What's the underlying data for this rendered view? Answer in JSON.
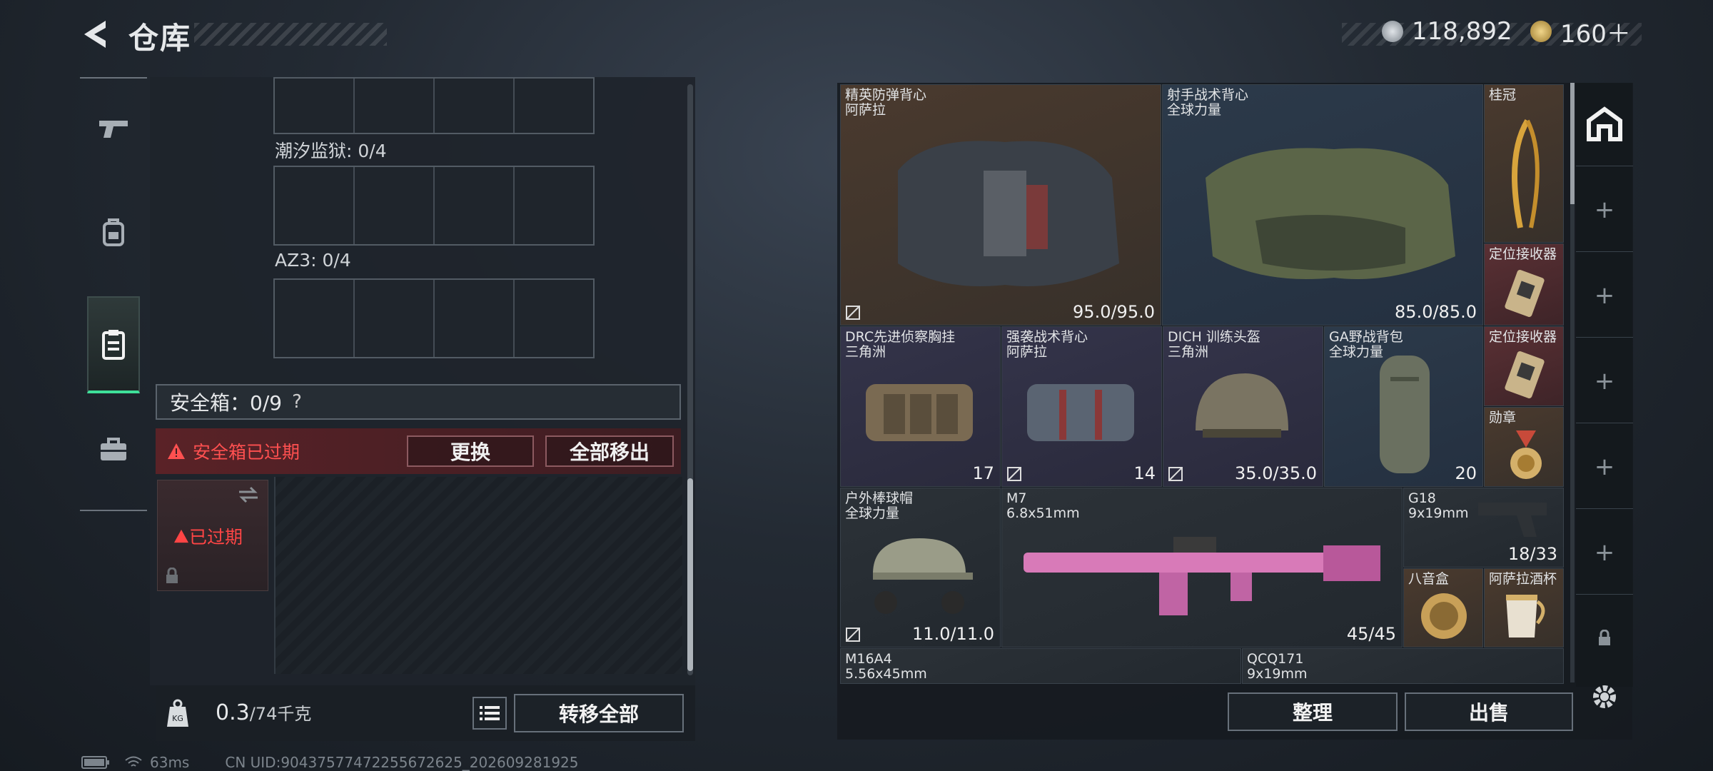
{
  "header": {
    "title": "仓库"
  },
  "currency": [
    {
      "icon": "silver-coin-icon",
      "value": "118,892"
    },
    {
      "icon": "gold-coin-icon",
      "value": "160＋"
    }
  ],
  "left_rail": [
    {
      "icon": "pistol-icon"
    },
    {
      "icon": "backpack-icon"
    },
    {
      "icon": "clipboard-icon",
      "active": true
    },
    {
      "icon": "toolbox-icon"
    }
  ],
  "container_sections": [
    {
      "label": "潮汐监狱: 0/4"
    },
    {
      "label": "AZ3: 0/4"
    }
  ],
  "safe_box": {
    "label": "安全箱：0/9",
    "help": "?",
    "warning": "安全箱已过期",
    "replace_button": "更换",
    "remove_all_button": "全部移出",
    "expired_label": "已过期"
  },
  "weight": {
    "current": "0.3",
    "max": "/74千克",
    "transfer_all_button": "转移全部"
  },
  "inventory": [
    {
      "name": "精英防弹背心\n阿萨拉",
      "value": "95.0/95.0",
      "color": "brown"
    },
    {
      "name": "射手战术背心\n全球力量",
      "value": "85.0/85.0",
      "color": "blue"
    },
    {
      "name": "桂冠",
      "value": "",
      "color": "brown"
    },
    {
      "name": "定位接收器",
      "value": "",
      "color": "red"
    },
    {
      "name": "DRC先进侦察胸挂\n三角洲",
      "value": "17",
      "color": "purple"
    },
    {
      "name": "强袭战术背心\n阿萨拉",
      "value": "14",
      "color": "purple"
    },
    {
      "name": "DICH 训练头盔\n三角洲",
      "value": "35.0/35.0",
      "color": "purple"
    },
    {
      "name": "GA野战背包\n全球力量",
      "value": "20",
      "color": "blue"
    },
    {
      "name": "定位接收器",
      "value": "",
      "color": "red"
    },
    {
      "name": "勋章",
      "value": "",
      "color": "brown"
    },
    {
      "name": "户外棒球帽\n全球力量",
      "value": "11.0/11.0",
      "color": "gray"
    },
    {
      "name": "M7\n6.8x51mm",
      "value": "45/45",
      "color": "gray"
    },
    {
      "name": "G18\n9x19mm",
      "value": "18/33",
      "color": "gray"
    },
    {
      "name": "八音盒",
      "value": "",
      "color": "brown"
    },
    {
      "name": "阿萨拉酒杯",
      "value": "",
      "color": "brown"
    },
    {
      "name": "M16A4\n5.56x45mm",
      "value": "",
      "color": "gray"
    },
    {
      "name": "QCQ171\n9x19mm",
      "value": "",
      "color": "gray"
    }
  ],
  "bottom_buttons": {
    "sort": "整理",
    "sell": "出售"
  },
  "right_rail": [
    "warehouse-icon",
    "plus-icon",
    "plus-icon",
    "plus-icon",
    "plus-icon",
    "plus-icon",
    "lock-icon"
  ],
  "status_bar": {
    "ping": "63ms",
    "uid": "CN UID:9043757747225567262​5_202609281925"
  },
  "colors": {
    "accent_green": "#3ee09a",
    "warning_red": "#ff5050"
  }
}
